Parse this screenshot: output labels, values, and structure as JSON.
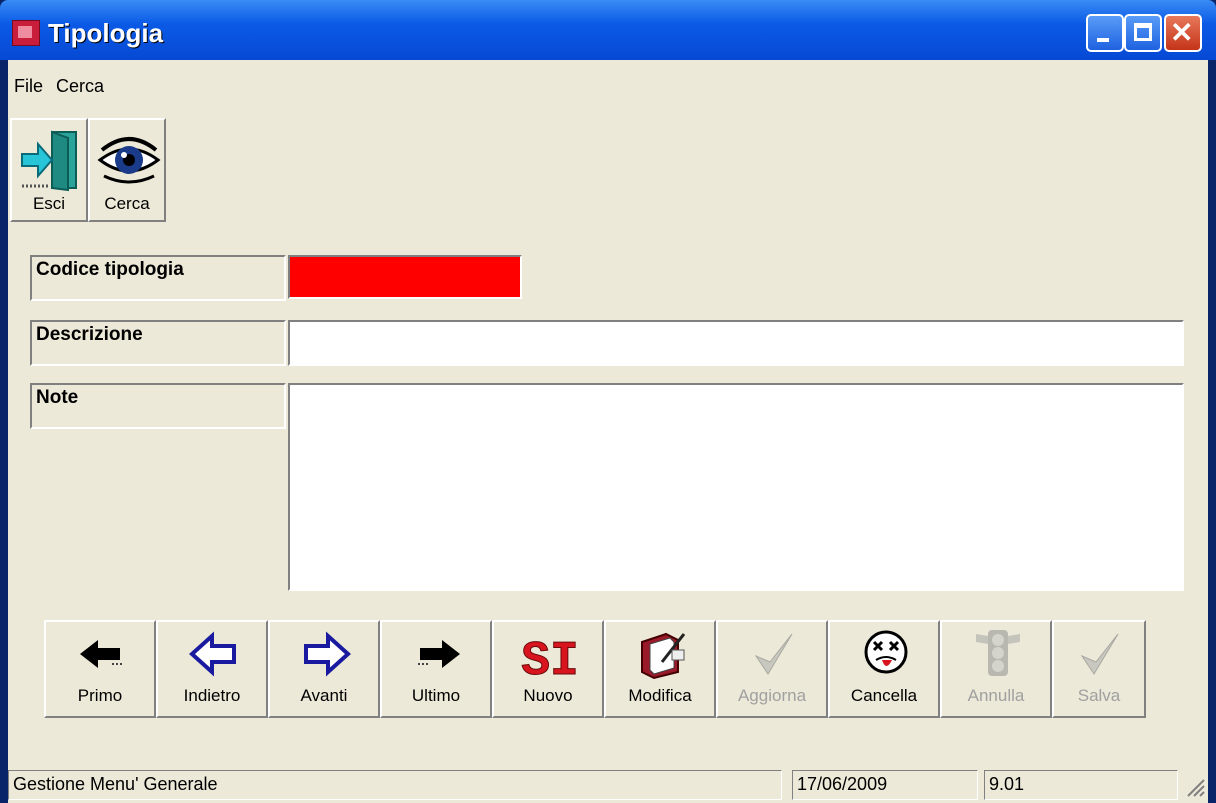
{
  "window": {
    "title": "Tipologia"
  },
  "menu": [
    "File",
    "Cerca"
  ],
  "toolbar": {
    "exit_label": "Esci",
    "search_label": "Cerca"
  },
  "form": {
    "code_label": "Codice tipologia",
    "code_value": "",
    "description_label": "Descrizione",
    "description_value": "",
    "notes_label": "Note",
    "notes_value": ""
  },
  "nav": {
    "first": "Primo",
    "prev": "Indietro",
    "next": "Avanti",
    "last": "Ultimo",
    "new": "Nuovo",
    "edit": "Modifica",
    "update": "Aggiorna",
    "delete": "Cancella",
    "cancel": "Annulla",
    "save": "Salva",
    "new_icon_text": "SI"
  },
  "status": {
    "message": "Gestione Menu' Generale",
    "date": "17/06/2009",
    "version": "9.01"
  },
  "colors": {
    "code_field_bg": "#ff0000",
    "titlebar": "#0a5ae6"
  }
}
